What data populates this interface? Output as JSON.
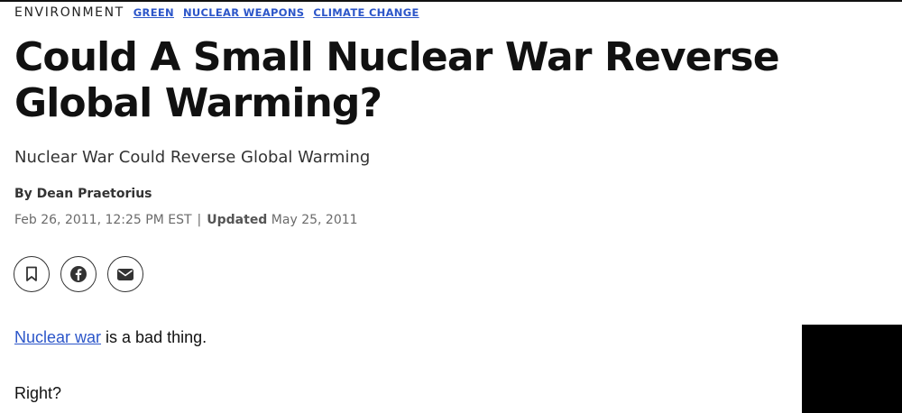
{
  "article": {
    "section": "ENVIRONMENT",
    "tags": [
      "GREEN",
      "NUCLEAR WEAPONS",
      "CLIMATE CHANGE"
    ],
    "headline": "Could A Small Nuclear War Reverse Global Warming?",
    "subheadline": "Nuclear War Could Reverse Global Warming",
    "byline": "By Dean Praetorius",
    "published": "Feb 26, 2011, 12:25 PM EST",
    "separator": "|",
    "updated_label": "Updated",
    "updated_date": "May 25, 2011",
    "body": {
      "p1_link": "Nuclear war",
      "p1_rest": " is a bad thing.",
      "p2": "Right?"
    }
  },
  "share": {
    "icons": [
      "bookmark-icon",
      "facebook-icon",
      "email-icon"
    ]
  },
  "colors": {
    "link": "#2c56c9",
    "headline": "#111111",
    "muted": "#6b6b6b",
    "ad_block": "#000000"
  }
}
